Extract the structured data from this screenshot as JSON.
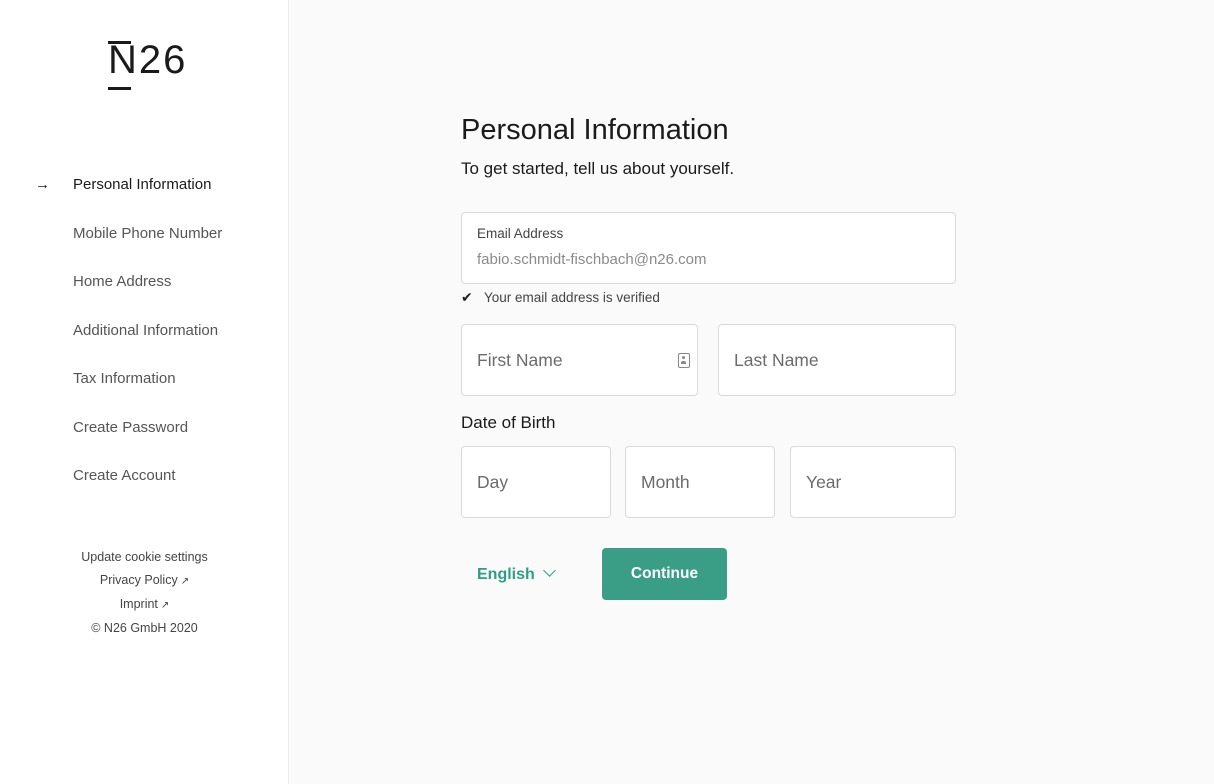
{
  "brand": {
    "logo_text": "N26"
  },
  "steps": [
    {
      "label": "Personal Information",
      "active": true
    },
    {
      "label": "Mobile Phone Number"
    },
    {
      "label": "Home Address"
    },
    {
      "label": "Additional Information"
    },
    {
      "label": "Tax Information"
    },
    {
      "label": "Create Password"
    },
    {
      "label": "Create Account"
    }
  ],
  "footer": {
    "cookie": "Update cookie settings",
    "privacy": "Privacy Policy",
    "imprint": "Imprint",
    "external_glyph": "↗",
    "copyright": "© N26 GmbH 2020"
  },
  "form": {
    "title": "Personal Information",
    "subtitle": "To get started, tell us about yourself.",
    "email": {
      "label": "Email Address",
      "value": "fabio.schmidt-fischbach@n26.com"
    },
    "verified_text": "Your email address is verified",
    "first_name": {
      "placeholder": "First Name"
    },
    "last_name": {
      "placeholder": "Last Name"
    },
    "dob_label": "Date of Birth",
    "day": {
      "placeholder": "Day"
    },
    "month": {
      "placeholder": "Month"
    },
    "year": {
      "placeholder": "Year"
    },
    "language": "English",
    "continue_label": "Continue"
  },
  "colors": {
    "accent": "#3a9e86",
    "link": "#2f9e82"
  },
  "icons": {
    "active_step": "arrow-right-icon",
    "verified": "check-icon",
    "autofill": "contact-card-icon",
    "language": "chevron-down-icon",
    "external": "external-link-icon"
  }
}
